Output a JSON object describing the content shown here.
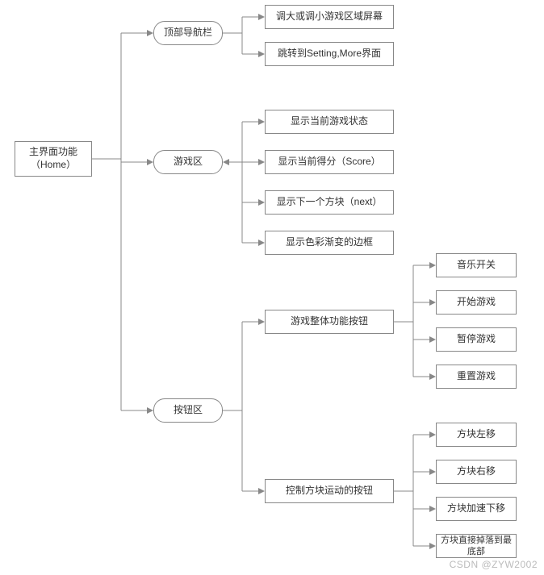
{
  "root": {
    "label": "主界面功能\n（Home）"
  },
  "level2": {
    "topnav": "顶部导航栏",
    "gamearea": "游戏区",
    "buttonarea": "按钮区"
  },
  "topnav_children": {
    "resize": "调大或调小游戏区域屏幕",
    "jump": "跳转到Setting,More界面"
  },
  "gamearea_children": {
    "status": "显示当前游戏状态",
    "score": "显示当前得分（Score）",
    "next": "显示下一个方块（next）",
    "border": "显示色彩渐变的边框"
  },
  "buttonarea_children": {
    "global_btn": "游戏整体功能按钮",
    "move_btn": "控制方块运动的按钮"
  },
  "global_btn_children": {
    "music": "音乐开关",
    "start": "开始游戏",
    "pause": "暂停游戏",
    "reset": "重置游戏"
  },
  "move_btn_children": {
    "left": "方块左移",
    "right": "方块右移",
    "accel": "方块加速下移",
    "drop": "方块直接掉落到最底部"
  },
  "watermark": "CSDN @ZYW2002"
}
